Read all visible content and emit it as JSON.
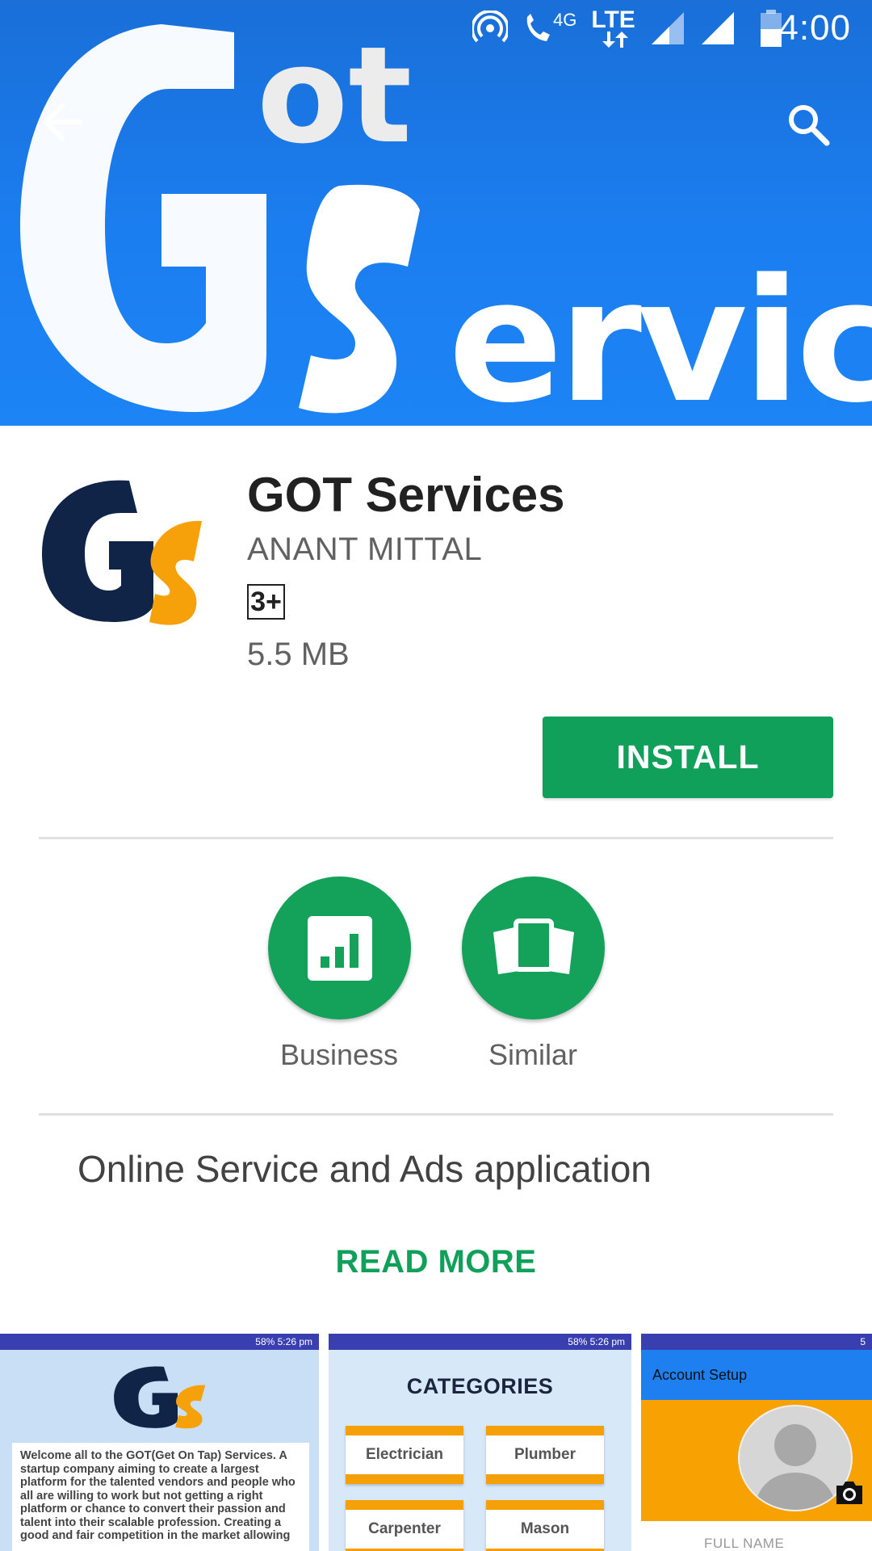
{
  "status_bar": {
    "time": "4:00",
    "network_label": "4G",
    "lte_label": "LTE"
  },
  "banner": {
    "logo_text_top": "ot",
    "logo_text_main": "ervices",
    "logo_letter_g": "G",
    "logo_letter_s": "S"
  },
  "toolbar": {
    "back_icon": "arrow-back-icon",
    "search_icon": "search-icon"
  },
  "app": {
    "title": "GOT Services",
    "developer": "ANANT MITTAL",
    "content_rating": "3+",
    "size": "5.5 MB",
    "install_label": "INSTALL",
    "icon_letters": "Gs"
  },
  "categories": [
    {
      "label": "Business",
      "icon": "bar-chart-icon"
    },
    {
      "label": "Similar",
      "icon": "cards-icon"
    }
  ],
  "description": "Online Service and Ads application",
  "read_more": "READ MORE",
  "screenshots": [
    {
      "status_text": "58% 5:26 pm",
      "welcome_text": "Welcome all to the GOT(Get On Tap) Services. A startup company aiming to create a largest platform for the talented vendors and people who all are willing to work but not getting a right platform or chance to convert their passion and talent into their scalable profession. Creating a good and fair competition in the market allowing"
    },
    {
      "status_text": "58% 5:26 pm",
      "title": "CATEGORIES",
      "items": [
        "Electrician",
        "Plumber",
        "Carpenter",
        "Mason"
      ]
    },
    {
      "status_text": "5",
      "title": "Account Setup",
      "field_placeholder": "FULL NAME"
    }
  ],
  "colors": {
    "accent_green": "#11a05a",
    "banner_blue": "#1b7ef0",
    "logo_navy": "#0f2446",
    "logo_orange": "#f7a10a"
  }
}
